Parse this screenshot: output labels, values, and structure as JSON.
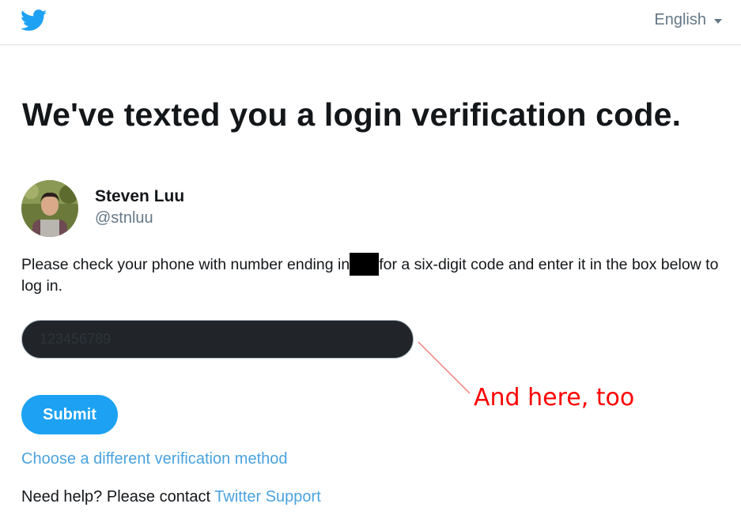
{
  "header": {
    "logo_icon": "twitter-bird-icon",
    "language_label": "English",
    "brand_color": "#1da1f2"
  },
  "main": {
    "title": "We've texted you a login verification code.",
    "user": {
      "name": "Steven Luu",
      "handle": "@stnluu",
      "avatar_icon": "avatar-photo"
    },
    "instructions_before": "Please check your phone with number ending in",
    "instructions_after": "for a six-digit code and enter it in the box below to log in.",
    "code_input": {
      "placeholder": "123456789",
      "value": ""
    },
    "submit_label": "Submit",
    "alt_method_link": "Choose a different verification method",
    "help_text": "Need help? Please contact",
    "help_link": "Twitter Support"
  },
  "annotation": {
    "text": "And here, too",
    "color": "#ff0000"
  }
}
